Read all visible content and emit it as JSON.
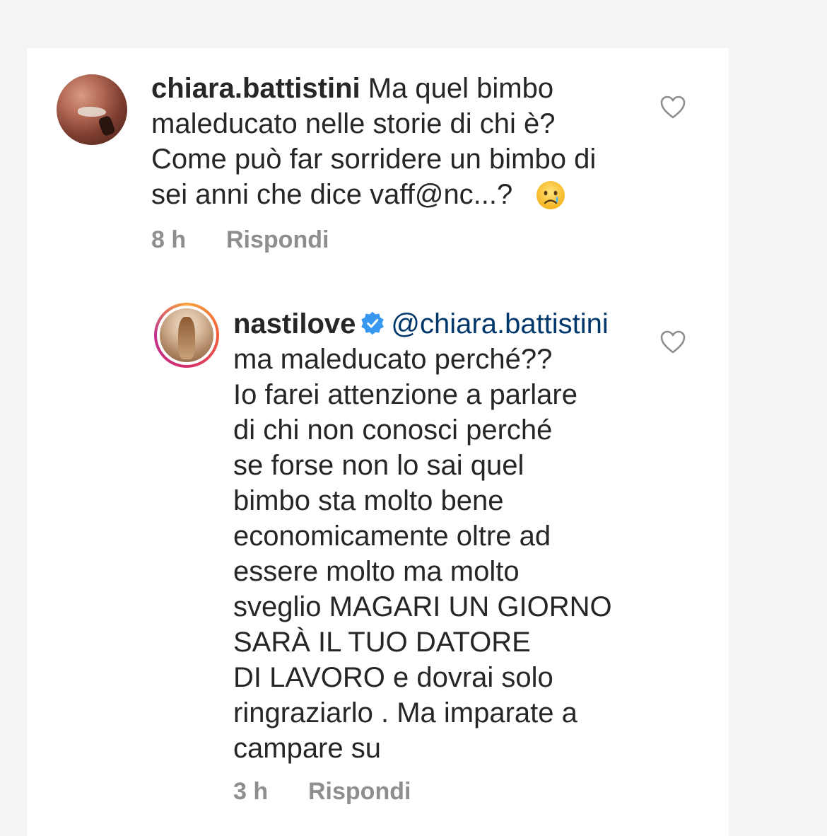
{
  "comments": [
    {
      "username": "chiara.battistini",
      "text_lines": [
        "Ma quel bimbo",
        "maleducato nelle storie di chi è?",
        "Come può far sorridere un bimbo di",
        "sei anni che dice vaff@nc...?"
      ],
      "emoji": "crying-face",
      "time": "8 h",
      "reply_label": "Rispondi"
    },
    {
      "username": "nastilove",
      "verified": true,
      "mention": "@chiara.battistini",
      "text_lines": [
        "ma maleducato perché??",
        "Io farei attenzione a parlare",
        "di chi non conosci perché",
        "se forse non lo sai quel",
        "bimbo sta molto bene",
        "economicamente oltre ad",
        "essere molto ma molto",
        "sveglio MAGARI UN GIORNO",
        "SARÀ IL TUO DATORE",
        "DI LAVORO e dovrai solo",
        "ringraziarlo . Ma imparate a",
        "campare su"
      ],
      "time": "3 h",
      "reply_label": "Rispondi"
    }
  ],
  "colors": {
    "background": "#f4f4f4",
    "card": "#ffffff",
    "text": "#262626",
    "meta": "#8e8e8e",
    "mention": "#00376b",
    "verified": "#3897f0"
  },
  "icons": {
    "like": "heart-outline-icon",
    "verified": "verified-badge-icon"
  }
}
